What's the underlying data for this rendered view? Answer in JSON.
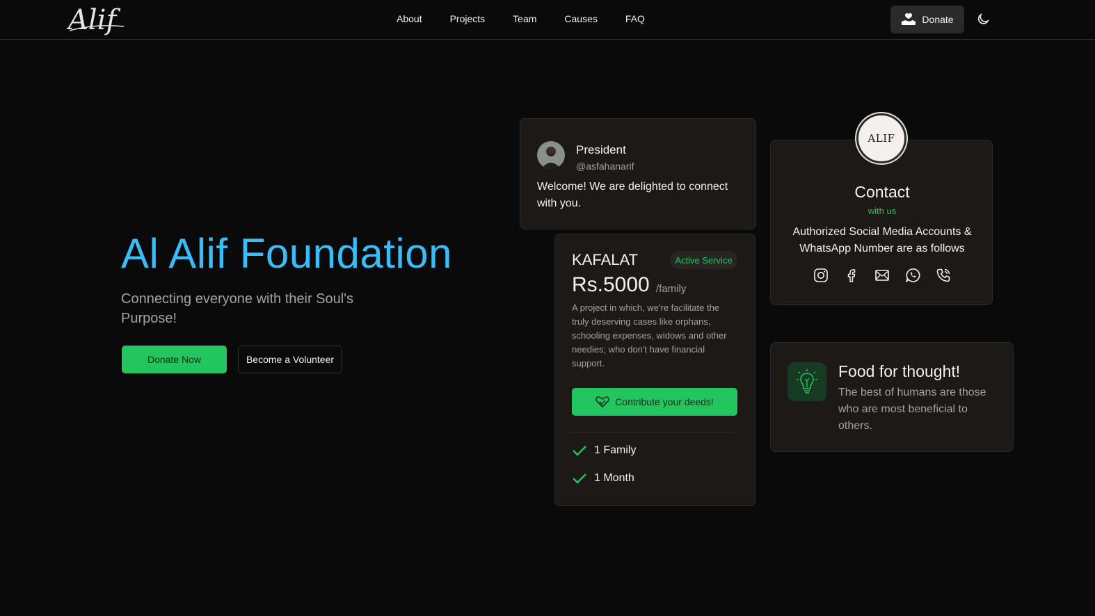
{
  "nav": {
    "links": [
      "About",
      "Projects",
      "Team",
      "Causes",
      "FAQ"
    ],
    "donate_label": "Donate"
  },
  "hero": {
    "title": "Al Alif Foundation",
    "subtitle": "Connecting everyone with their Soul's Purpose!",
    "primary_button": "Donate Now",
    "secondary_button": "Become a Volunteer"
  },
  "president_card": {
    "name": "President",
    "handle": "@asfahanarif",
    "message": "Welcome! We are delighted to connect with you."
  },
  "kafalat_card": {
    "title": "KAFALAT",
    "badge": "Active Service",
    "price": "Rs.5000",
    "unit": "/family",
    "description": "A project in which, we're facilitate the truly deserving cases like orphans, schooling expenses, widows and other needies; who don't have financial support.",
    "button": "Contribute your deeds!",
    "features": [
      "1 Family",
      "1 Month"
    ]
  },
  "contact_card": {
    "logo_text": "ALIF",
    "title": "Contact",
    "subtitle": "with us",
    "description": "Authorized Social Media Accounts & WhatsApp Number are as follows",
    "icons": [
      "instagram-icon",
      "facebook-icon",
      "mail-icon",
      "whatsapp-icon",
      "phone-icon"
    ]
  },
  "food_card": {
    "title": "Food for thought!",
    "text": "The best of humans are those who are most beneficial to others."
  },
  "colors": {
    "accent_green": "#22c55e",
    "title_blue": "#38bdf8",
    "background": "#0b0a0a",
    "card": "#1c1917"
  }
}
